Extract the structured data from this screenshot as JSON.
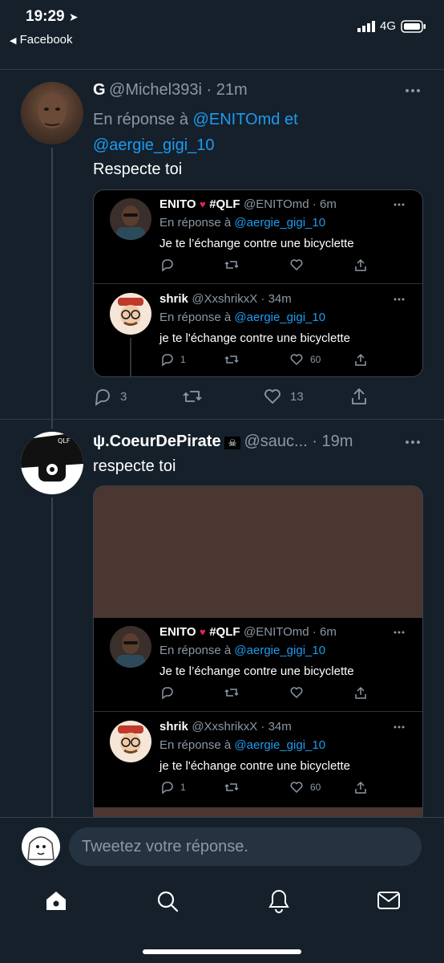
{
  "status": {
    "time": "19:29",
    "back_app": "Facebook",
    "network": "4G"
  },
  "tweet1": {
    "name": "G",
    "handle": "@Michel393i",
    "time": "21m",
    "reply_prefix": "En réponse à",
    "reply_to_1": "@ENITOmd",
    "reply_and": "et",
    "reply_to_2": "@aergie_gigi_10",
    "text": "Respecte toi",
    "replies": "3",
    "likes": "13"
  },
  "quote_a": {
    "name": "ENITO",
    "tag": "#QLF",
    "handle": "@ENITOmd",
    "time": "6m",
    "reply_prefix": "En réponse à",
    "reply_to": "@aergie_gigi_10",
    "text": "Je te l’échange contre une bicyclette"
  },
  "quote_b": {
    "name": "shrik",
    "handle": "@XxshrikxX",
    "time": "34m",
    "reply_prefix": "En réponse à",
    "reply_to": "@aergie_gigi_10",
    "text": "je te l'échange contre une bicyclette",
    "replies": "1",
    "likes": "60"
  },
  "tweet2": {
    "name": "ψ.CoeurDePirate",
    "handle": "@sauc...",
    "time": "19m",
    "text": "respecte toi",
    "avatar_text": "QLF"
  },
  "reply_bar": {
    "placeholder": "Tweetez votre réponse."
  },
  "colors": {
    "background": "#15202b",
    "link": "#1d9bf0",
    "muted": "#8b98a5"
  }
}
